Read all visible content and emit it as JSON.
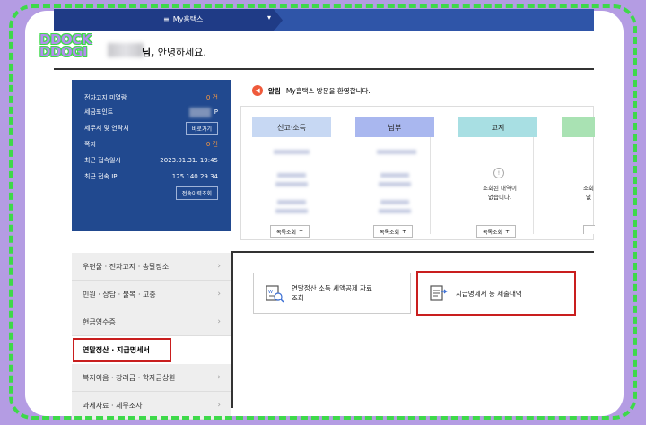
{
  "nav": {
    "menu_label": "My홈택스",
    "menu_icon": "hamburger-icon"
  },
  "watermark": {
    "line1": "DDOCK",
    "line2": "DDOGI"
  },
  "greeting": {
    "name_suffix": "님,",
    "text": " 안녕하세요."
  },
  "summary": {
    "rows": [
      {
        "label": "전자고지 미열람",
        "value": "0 건"
      },
      {
        "label": "세금포인트",
        "value": "P"
      },
      {
        "label": "세무서 및 연락처",
        "button": "바로가기"
      },
      {
        "label": "쪽지",
        "value": "0 건"
      },
      {
        "label": "최근 접속일시",
        "value": "2023.01.31. 19:45"
      },
      {
        "label": "최근 접속 IP",
        "value": "125.140.29.34"
      }
    ],
    "history_button": "접속이력조회"
  },
  "alert": {
    "title": "알림",
    "message": "My홈택스 방문을 환영합니다."
  },
  "columns": [
    {
      "header": "신고·소득",
      "color": "#c7d8f3",
      "list_button": "목록조회"
    },
    {
      "header": "납부",
      "color": "#a9b7ef",
      "list_button": "목록조회"
    },
    {
      "header": "고지",
      "color": "#a8dfe3",
      "list_button": "목록조회",
      "empty": "조회된 내역이\n없습니다."
    },
    {
      "header": "",
      "color": "#a9e2b3",
      "list_button": "목",
      "empty": "조회\n없"
    }
  ],
  "sidemenu": [
    {
      "label": "우편물 · 전자고지 · 송달장소"
    },
    {
      "label": "민원 · 상담 · 불복 · 고충"
    },
    {
      "label": "현금영수증"
    },
    {
      "label": "연말정산 · 지급명세서",
      "active": true
    },
    {
      "label": "복지이음 · 장려금 · 학자금상환"
    },
    {
      "label": "과세자료 · 세무조사"
    }
  ],
  "services": [
    {
      "label": "연말정산 소득 세액공제 자료\n조회"
    },
    {
      "label": "지급명세서 등 제출내역"
    }
  ]
}
